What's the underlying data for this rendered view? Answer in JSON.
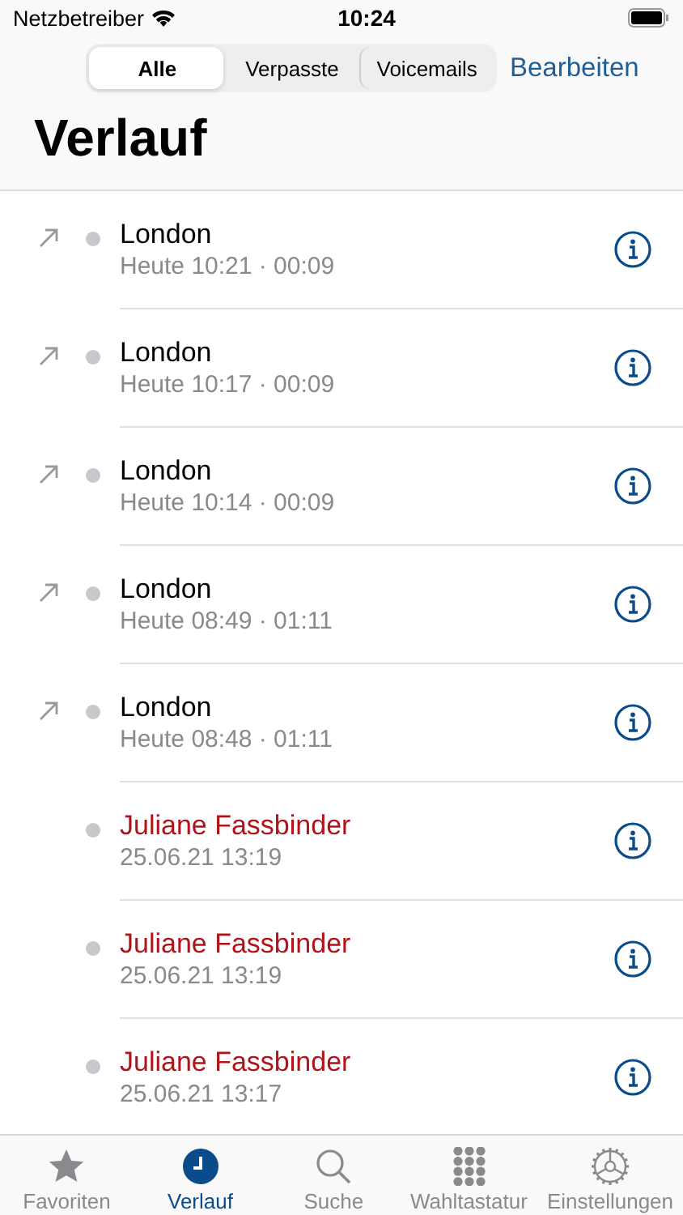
{
  "status_bar": {
    "carrier": "Netzbetreiber",
    "time": "10:24"
  },
  "segments": [
    {
      "label": "Alle",
      "selected": true
    },
    {
      "label": "Verpasste",
      "selected": false
    },
    {
      "label": "Voicemails",
      "selected": false
    }
  ],
  "edit_button": "Bearbeiten",
  "title": "Verlauf",
  "calls": [
    {
      "name": "London",
      "detail": "Heute 10:21 · 00:09",
      "outgoing": true,
      "missed": false
    },
    {
      "name": "London",
      "detail": "Heute 10:17 · 00:09",
      "outgoing": true,
      "missed": false
    },
    {
      "name": "London",
      "detail": "Heute 10:14 · 00:09",
      "outgoing": true,
      "missed": false
    },
    {
      "name": "London",
      "detail": "Heute 08:49 · 01:11",
      "outgoing": true,
      "missed": false
    },
    {
      "name": "London",
      "detail": "Heute 08:48 · 01:11",
      "outgoing": true,
      "missed": false
    },
    {
      "name": "Juliane Fassbinder",
      "detail": "25.06.21 13:19",
      "outgoing": false,
      "missed": true
    },
    {
      "name": "Juliane Fassbinder",
      "detail": "25.06.21 13:19",
      "outgoing": false,
      "missed": true
    },
    {
      "name": "Juliane Fassbinder",
      "detail": "25.06.21 13:17",
      "outgoing": false,
      "missed": true
    }
  ],
  "tabs": [
    {
      "kind": "favorites",
      "label": "Favoriten",
      "selected": false
    },
    {
      "kind": "recents",
      "label": "Verlauf",
      "selected": true
    },
    {
      "kind": "search",
      "label": "Suche",
      "selected": false
    },
    {
      "kind": "keypad",
      "label": "Wahltastatur",
      "selected": false
    },
    {
      "kind": "settings",
      "label": "Einstellungen",
      "selected": false
    }
  ]
}
